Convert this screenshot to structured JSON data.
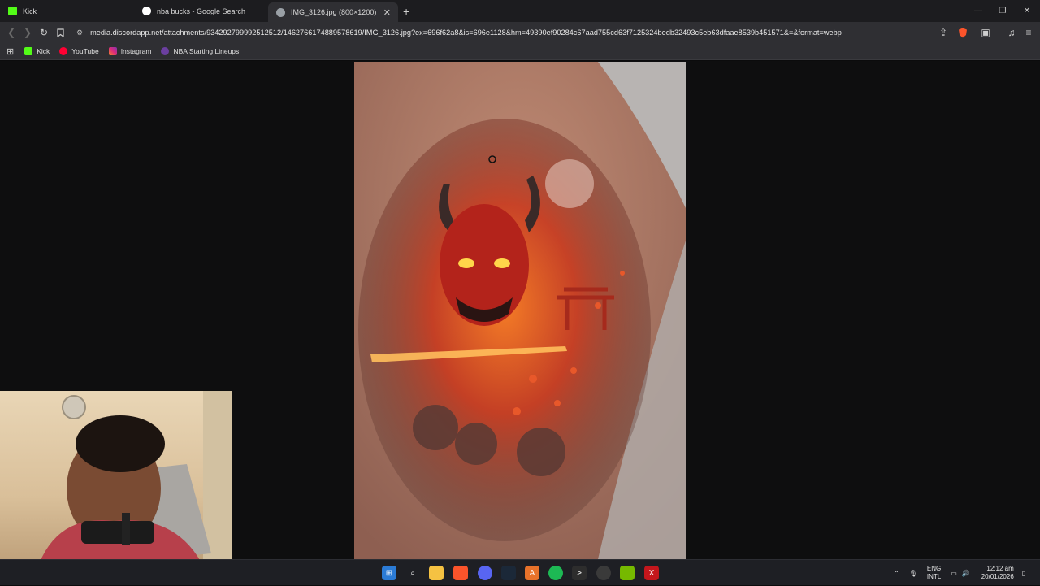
{
  "tabs": [
    {
      "label": "Kick",
      "icon": "kick-icon",
      "color": "#53fc18",
      "active": false
    },
    {
      "label": "nba bucks - Google Search",
      "icon": "google-icon",
      "color": "#ffffff",
      "active": false
    },
    {
      "label": "IMG_3126.jpg (800×1200)",
      "icon": "image-tab-icon",
      "color": "#9aa0a6",
      "active": true
    }
  ],
  "toolbar": {
    "url": "media.discordapp.net/attachments/934292799992512512/1462766174889578619/IMG_3126.jpg?ex=696f62a8&is=696e1128&hm=49390ef90284c67aad755cd63f7125324bedb32493c5eb63dfaae8539b451571&=&format=webp"
  },
  "bookmarks": [
    {
      "label": "Kick",
      "icon": "kick-icon",
      "color": "#53fc18"
    },
    {
      "label": "YouTube",
      "icon": "youtube-icon",
      "color": "#ff0033"
    },
    {
      "label": "Instagram",
      "icon": "instagram-icon",
      "color": "#e1306c"
    },
    {
      "label": "NBA Starting Lineups",
      "icon": "nba-icon",
      "color": "#6b3fa0"
    }
  ],
  "image": {
    "name": "IMG_3126.jpg",
    "description_icon": "oni-mask-tattoo-image"
  },
  "taskbar": {
    "apps": [
      "windows-start-icon",
      "search-icon",
      "file-explorer-icon",
      "brave-icon",
      "discord-icon",
      "steam-icon",
      "app-a-icon",
      "spotify-icon",
      "terminal-icon",
      "obs-icon",
      "nvidia-icon",
      "app-x-icon"
    ],
    "lang_top": "ENG",
    "lang_bottom": "INTL",
    "time": "12:12 am",
    "date": "20/01/2026"
  }
}
